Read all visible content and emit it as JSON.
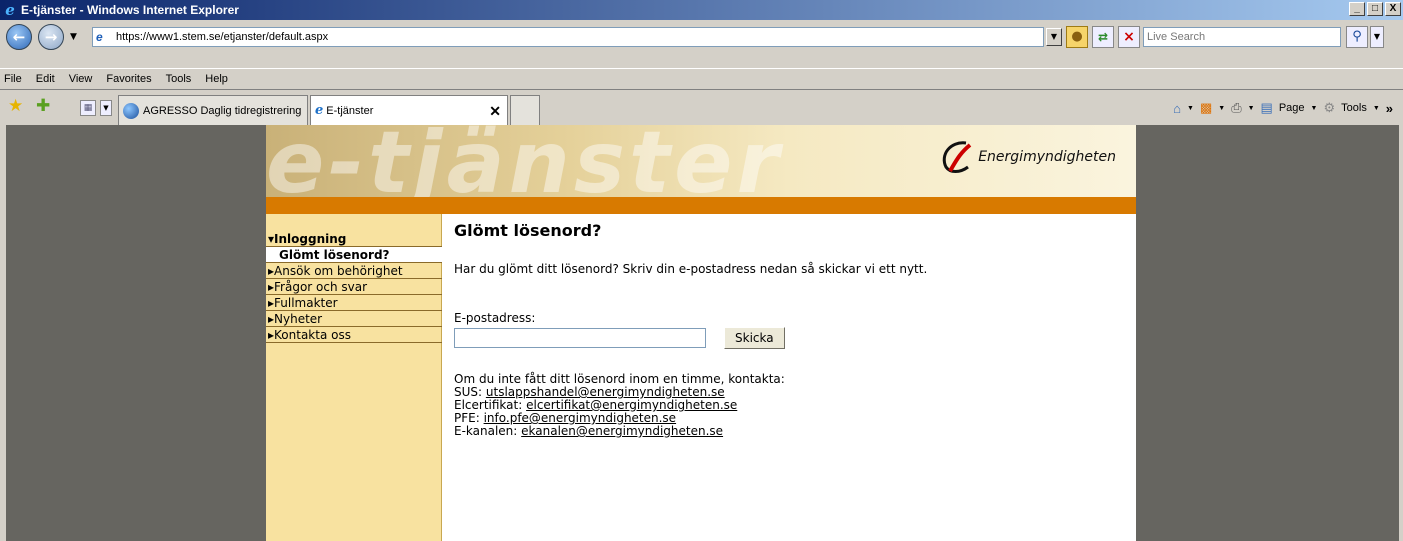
{
  "window": {
    "title": "E-tjänster - Windows Internet Explorer",
    "minimize": "_",
    "maximize": " ",
    "close": "X"
  },
  "address_bar": {
    "url": "https://www1.stem.se/etjanster/default.aspx",
    "search_placeholder": "Live Search"
  },
  "menu": [
    "File",
    "Edit",
    "View",
    "Favorites",
    "Tools",
    "Help"
  ],
  "tabs": [
    {
      "label": "AGRESSO Daglig tidregistrering"
    },
    {
      "label": "E-tjänster",
      "active": true
    }
  ],
  "command_bar": {
    "page_label": "Page",
    "tools_label": "Tools"
  },
  "site": {
    "banner_word": "e-tjänster",
    "logo_text": "Energimyndigheten",
    "colors": {
      "orange": "#d87a00",
      "sidebar": "#f8e2a0",
      "background": "#666560"
    }
  },
  "nav": {
    "section_head": "Inloggning",
    "selected": "Glömt lösenord?",
    "items": [
      "Ansök om behörighet",
      "Frågor och svar",
      "Fullmakter",
      "Nyheter",
      "Kontakta oss"
    ]
  },
  "content": {
    "heading": "Glömt lösenord?",
    "intro": "Har du glömt ditt lösenord? Skriv din e-postadress nedan så skickar vi ett nytt.",
    "email_label": "E-postadress:",
    "email_value": "",
    "submit_label": "Skicka",
    "contact_intro": "Om du inte fått ditt lösenord inom en timme, kontakta:",
    "contacts": [
      {
        "label": "SUS:",
        "email": "utslappshandel@energimyndigheten.se"
      },
      {
        "label": "Elcertifikat:",
        "email": "elcertifikat@energimyndigheten.se"
      },
      {
        "label": "PFE:",
        "email": "info.pfe@energimyndigheten.se"
      },
      {
        "label": "E-kanalen:",
        "email": "ekanalen@energimyndigheten.se"
      }
    ]
  }
}
